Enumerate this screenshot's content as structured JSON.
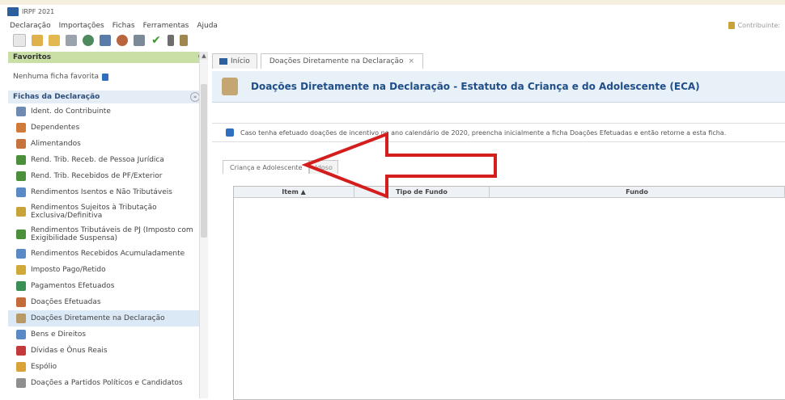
{
  "window": {
    "title": "IRPF 2021"
  },
  "menu": [
    "Declaração",
    "Importações",
    "Fichas",
    "Ferramentas",
    "Ajuda"
  ],
  "contribuinte_label": "Contribuinte:",
  "toolbar": [
    "new-icon",
    "open-icon",
    "folder-icon",
    "trash-icon",
    "globe-icon",
    "import-icon",
    "network-icon",
    "print-icon",
    "check-icon",
    "list-icon",
    "book-icon"
  ],
  "colors": {
    "favorites_header": "#c9dfa6",
    "fichas_header": "#e4ecf5",
    "banner_bg": "#e8f0f8",
    "title_blue": "#1f4e88",
    "arrow_red": "#d41e1e"
  },
  "sidebar": {
    "favorites_title": "Favoritos",
    "favorites_empty": "Nenhuma ficha favorita",
    "fichas_title": "Fichas da Declaração",
    "items": [
      {
        "label": "Ident. do Contribuinte",
        "icon": "id-card-icon",
        "color": "#6f8bb3"
      },
      {
        "label": "Dependentes",
        "icon": "people-icon",
        "color": "#d17b3a"
      },
      {
        "label": "Alimentandos",
        "icon": "family-icon",
        "color": "#c6733e"
      },
      {
        "label": "Rend. Trib. Receb. de Pessoa Jurídica",
        "icon": "money-arrow-icon",
        "color": "#4c8f3a"
      },
      {
        "label": "Rend. Trib. Recebidos de PF/Exterior",
        "icon": "world-money-icon",
        "color": "#4c8f3a"
      },
      {
        "label": "Rendimentos Isentos e Não Tributáveis",
        "icon": "doc-icon",
        "color": "#5b8bc6"
      },
      {
        "label": "Rendimentos Sujeitos à Tributação\nExclusiva/Definitiva",
        "icon": "doc-lock-icon",
        "color": "#c9a23a"
      },
      {
        "label": "Rendimentos Tributáveis de PJ (Imposto com\nExigibilidade Suspensa)",
        "icon": "money-pause-icon",
        "color": "#4c8f3a"
      },
      {
        "label": "Rendimentos Recebidos Acumuladamente",
        "icon": "doc-stack-icon",
        "color": "#5b8bc6"
      },
      {
        "label": "Imposto Pago/Retido",
        "icon": "person-money-icon",
        "color": "#d1a93a"
      },
      {
        "label": "Pagamentos Efetuados",
        "icon": "card-icon",
        "color": "#3a8f55"
      },
      {
        "label": "Doações Efetuadas",
        "icon": "gift-doc-icon",
        "color": "#c46c3a"
      },
      {
        "label": "Doações Diretamente na Declaração",
        "icon": "hand-heart-icon",
        "color": "#b79a66",
        "selected": true
      },
      {
        "label": "Bens e Direitos",
        "icon": "house-icon",
        "color": "#5b8bc6"
      },
      {
        "label": "Dívidas e Ônus Reais",
        "icon": "debt-icon",
        "color": "#c43a3a"
      },
      {
        "label": "Espólio",
        "icon": "estate-icon",
        "color": "#d9a33a"
      },
      {
        "label": "Doações a Partidos Políticos e Candidatos",
        "icon": "candidate-icon",
        "color": "#8f8f8f"
      }
    ]
  },
  "tabs": [
    {
      "label": "Início"
    },
    {
      "label": "Doações Diretamente na Declaração"
    }
  ],
  "tab_close": "×",
  "banner_title": "Doações Diretamente na Declaração - Estatuto da Criança e do Adolescente (ECA)",
  "info_text": "Caso tenha efetuado doações de incentivo no ano calendário de 2020, preencha inicialmente a ficha Doações Efetuadas e então retorne a esta ficha.",
  "subtabs": [
    {
      "label": "Criança e Adolescente"
    },
    {
      "label": "Idoso"
    }
  ],
  "grid_headers": [
    "Item ▲",
    "Tipo de Fundo",
    "Fundo"
  ]
}
